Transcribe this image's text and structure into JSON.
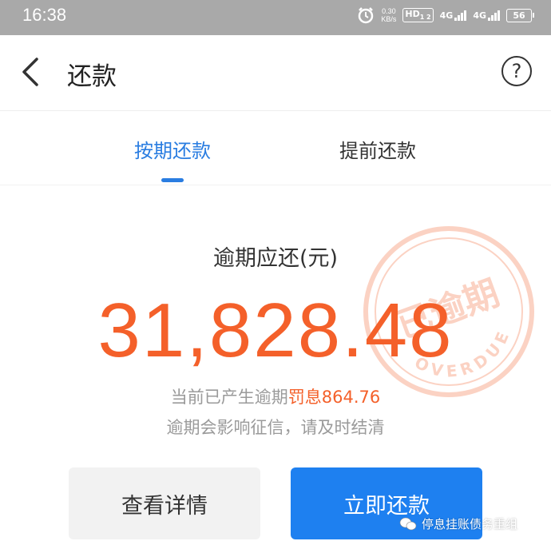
{
  "status_bar": {
    "time": "16:38",
    "net_speed_value": "0.30",
    "net_speed_unit": "KB/s",
    "hd_badge": "HD",
    "hd_sub": "1 2",
    "network_1": "4G",
    "network_2": "4G",
    "battery": "56"
  },
  "nav": {
    "title": "还款",
    "help_symbol": "?"
  },
  "tabs": [
    {
      "label": "按期还款",
      "active": true
    },
    {
      "label": "提前还款",
      "active": false
    }
  ],
  "summary": {
    "amount_label": "逾期应还(元)",
    "amount": "31,828.48",
    "penalty_prefix": "当前已产生逾期",
    "penalty_label": "罚息",
    "penalty_value": "864.76",
    "warning": "逾期会影响征信，请及时结清"
  },
  "stamp": {
    "text": "已逾期",
    "subtext": "OVERDUE"
  },
  "buttons": {
    "detail": "查看详情",
    "pay": "立即还款"
  },
  "watermark": {
    "text": "停息挂账债务重组",
    "icon": "wechat-icon"
  },
  "colors": {
    "accent_blue": "#1e80f0",
    "amount_orange": "#f4602a",
    "status_bar_gray": "#a9a9a9"
  }
}
